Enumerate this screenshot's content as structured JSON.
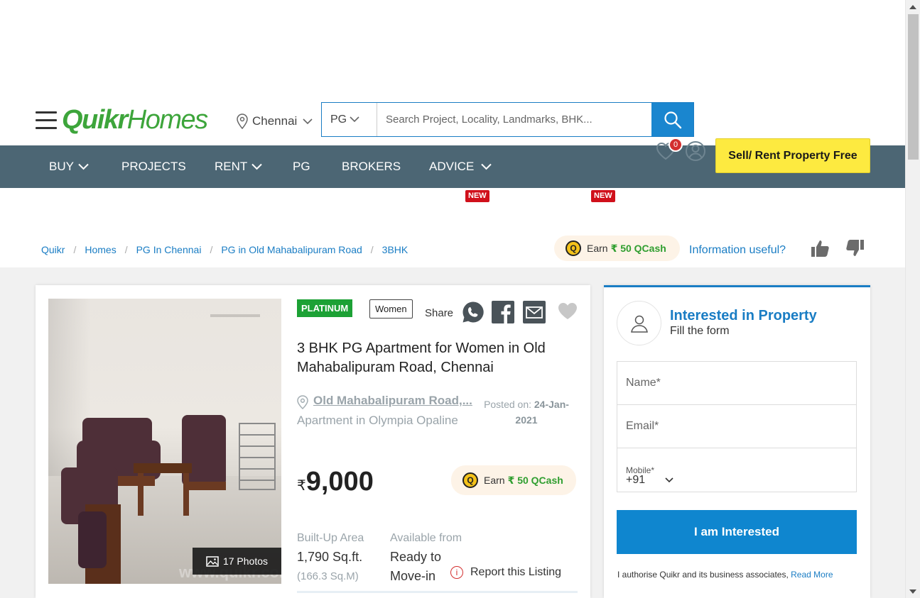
{
  "header": {
    "logo_part1": "Quikr",
    "logo_part2": "Homes",
    "city": "Chennai",
    "search_type": "PG",
    "search_placeholder": "Search Project, Locality, Landmarks, BHK..."
  },
  "nav": {
    "items": [
      {
        "label": "BUY"
      },
      {
        "label": "PROJECTS"
      },
      {
        "label": "RENT"
      },
      {
        "label": "PG"
      },
      {
        "label": "BROKERS"
      },
      {
        "label": "ADVICE"
      }
    ],
    "new_badge_1": "NEW",
    "new_badge_2": "NEW",
    "favorites_count": "0",
    "sell_button": "Sell/ Rent Property Free"
  },
  "breadcrumb": {
    "items": [
      "Quikr",
      "Homes",
      "PG In Chennai",
      "PG in Old Mahabalipuram Road",
      "3BHK"
    ],
    "separator": "/"
  },
  "top_qcash": {
    "coin": "Q",
    "label": "Earn",
    "amount": "₹ 50 QCash"
  },
  "feedback": {
    "question": "Information useful?"
  },
  "listing": {
    "tag_platinum": "PLATINUM",
    "tag_gender": "Women",
    "share_label": "Share",
    "title": "3 BHK PG Apartment for Women in Old Mahabalipuram Road, Chennai",
    "locality_link": "Old Mahabalipuram Road,...",
    "project": "Apartment in Olympia Opaline",
    "posted_label": "Posted on:",
    "posted_date": "24-Jan-2021",
    "currency": "₹",
    "price": "9,000",
    "qcash_coin": "Q",
    "qcash_label": "Earn",
    "qcash_amount": "₹ 50 QCash",
    "photos_count": "17 Photos",
    "watermark": "www.quikr.com",
    "area_label": "Built-Up Area",
    "area_value": "1,790 Sq.ft.",
    "area_sub": "(166.3 Sq.M)",
    "avail_label": "Available from",
    "avail_value_line1": "Ready to",
    "avail_value_line2": "Move-in",
    "report": "Report this Listing",
    "report_icon": "i"
  },
  "form": {
    "title": "Interested in Property",
    "subtitle": "Fill the form",
    "name_placeholder": "Name*",
    "email_placeholder": "Email*",
    "mobile_label": "Mobile*",
    "country_code": "+91",
    "submit": "I am Interested",
    "authorise_text": "I authorise Quikr and its business associates,",
    "read_more": "Read More"
  },
  "colors": {
    "brand_green": "#3da53b",
    "nav_bg": "#4c6674",
    "link_blue": "#1a7dc4",
    "sell_yellow": "#fdea40",
    "platinum_green": "#1ca135"
  }
}
